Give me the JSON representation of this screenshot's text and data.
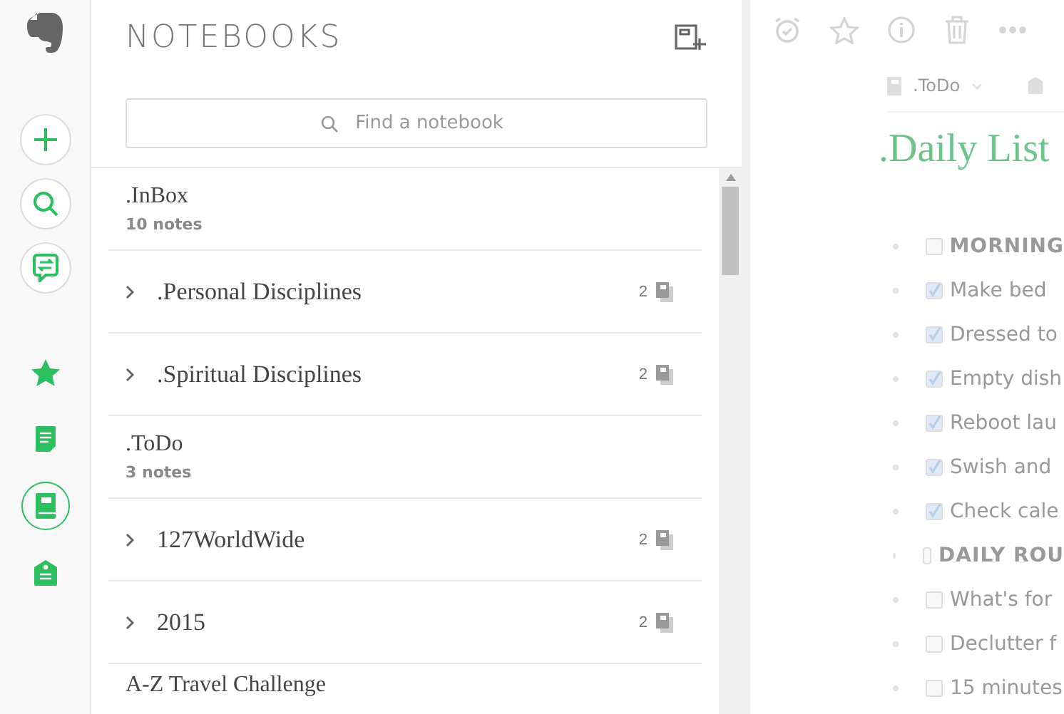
{
  "rail": {
    "top": [
      {
        "kind": "new"
      },
      {
        "kind": "search"
      },
      {
        "kind": "chat"
      }
    ],
    "nav": [
      {
        "kind": "shortcuts",
        "selected": false
      },
      {
        "kind": "notes",
        "selected": false
      },
      {
        "kind": "notebooks",
        "selected": true
      },
      {
        "kind": "tags",
        "selected": false
      }
    ]
  },
  "notebooks_panel": {
    "title": "NOTEBOOKS",
    "search": {
      "placeholder": "Find a notebook"
    },
    "items": [
      {
        "kind": "notebook",
        "name": ".InBox",
        "notes": "10 notes"
      },
      {
        "kind": "stack",
        "name": ".Personal Disciplines",
        "count": "2"
      },
      {
        "kind": "stack",
        "name": ".Spiritual Disciplines",
        "count": "2"
      },
      {
        "kind": "notebook",
        "name": ".ToDo",
        "notes": "3 notes"
      },
      {
        "kind": "stack",
        "name": "127WorldWide",
        "count": "2"
      },
      {
        "kind": "stack",
        "name": "2015",
        "count": "2"
      },
      {
        "kind": "notebook",
        "name": "A-Z Travel Challenge"
      }
    ]
  },
  "note": {
    "notebook": ".ToDo",
    "title": ".Daily List",
    "items": [
      {
        "kind": "heading",
        "text": "MORNING",
        "checked": false
      },
      {
        "kind": "task",
        "text": "Make bed",
        "checked": true
      },
      {
        "kind": "task",
        "text": "Dressed to",
        "checked": true
      },
      {
        "kind": "task",
        "text": "Empty dish",
        "checked": true
      },
      {
        "kind": "task",
        "text": "Reboot lau",
        "checked": true
      },
      {
        "kind": "task",
        "text": "Swish and",
        "checked": true
      },
      {
        "kind": "task",
        "text": "Check cale",
        "checked": true
      },
      {
        "kind": "heading",
        "text": "DAILY ROU",
        "checked": false
      },
      {
        "kind": "task",
        "text": "What's for",
        "checked": false
      },
      {
        "kind": "task",
        "text": "Declutter f",
        "checked": false
      },
      {
        "kind": "task",
        "text": "15 minutes",
        "checked": false
      }
    ]
  }
}
